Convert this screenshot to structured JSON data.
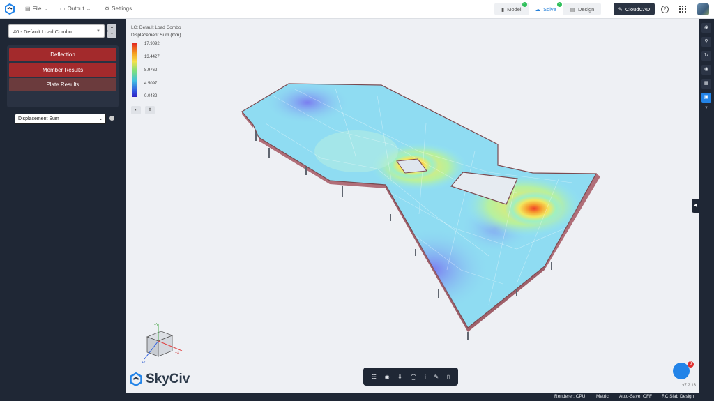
{
  "topbar": {
    "menu": [
      {
        "label": "File",
        "icon": "file-icon"
      },
      {
        "label": "Output",
        "icon": "monitor-icon"
      },
      {
        "label": "Settings",
        "icon": "gear-icon"
      }
    ],
    "tabs": [
      {
        "label": "Model",
        "status": "complete"
      },
      {
        "label": "Solve",
        "status": "complete",
        "active": true
      },
      {
        "label": "Design"
      }
    ],
    "cloudcad_label": "CloudCAD",
    "help_label": "?"
  },
  "sidebar": {
    "load_combo": "#0 - Default Load Combo",
    "buttons": [
      {
        "label": "Deflection"
      },
      {
        "label": "Member Results"
      },
      {
        "label": "Plate Results",
        "active": true
      }
    ],
    "result_type": "Displacement Sum"
  },
  "viewport": {
    "lc_label": "LC: Default Load Combo",
    "legend_title": "Displacement Sum (mm)",
    "legend_ticks": [
      "17.9092",
      "13.4427",
      "8.9762",
      "4.5097",
      "0.0432"
    ],
    "brand": "SkyCiv",
    "version": "v7.2.13",
    "notification_count": "3",
    "axes": {
      "y": "+Y",
      "x": "+X",
      "z": "+Z"
    }
  },
  "statusbar": {
    "renderer": "Renderer: CPU",
    "units": "Metric",
    "autosave": "Auto-Save: OFF",
    "module": "RC Slab Design"
  },
  "colors": {
    "accent": "#2384e8",
    "dark_panel": "#1f2735",
    "result_button": "#a32a2c"
  }
}
